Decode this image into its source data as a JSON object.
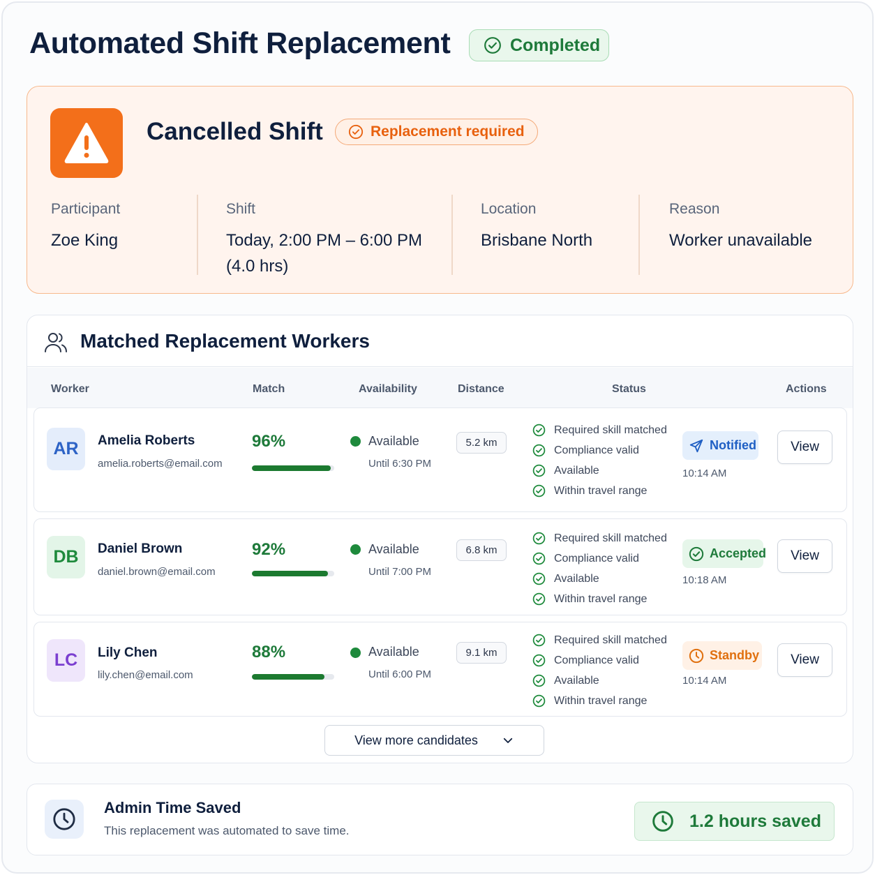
{
  "page": {
    "title": "Automated Shift Replacement",
    "status_badge": "Completed"
  },
  "cancelled": {
    "title": "Cancelled Shift",
    "badge": "Replacement required",
    "participant_label": "Participant",
    "participant_value": "Zoe King",
    "shift_label": "Shift",
    "shift_value_line1": "Today, 2:00 PM – 6:00 PM",
    "shift_value_line2": "(4.0 hrs)",
    "location_label": "Location",
    "location_value": "Brisbane North",
    "reason_label": "Reason",
    "reason_value": "Worker unavailable"
  },
  "matched": {
    "title": "Matched Replacement Workers",
    "columns": {
      "worker": "Worker",
      "match": "Match",
      "availability": "Availability",
      "distance": "Distance",
      "status": "Status",
      "actions": "Actions"
    },
    "rows": [
      {
        "initials": "AR",
        "name": "Amelia Roberts",
        "email": "amelia.roberts@email.com",
        "match": "96%",
        "match_value": 0.96,
        "availability": "Available",
        "until": "Until 6:30 PM",
        "distance": "5.2 km",
        "checks": [
          "Required skill matched",
          "Compliance valid",
          "Available",
          "Within travel range"
        ],
        "status": "Notified",
        "status_time": "10:14 AM",
        "action": "View",
        "colors": {
          "avatar_bg": "#e4edfb",
          "avatar_fg": "#2d63c6",
          "pill_bg": "#e4effc",
          "pill_fg": "#1f5fc4"
        }
      },
      {
        "initials": "DB",
        "name": "Daniel Brown",
        "email": "daniel.brown@email.com",
        "match": "92%",
        "match_value": 0.92,
        "availability": "Available",
        "until": "Until 7:00 PM",
        "distance": "6.8 km",
        "checks": [
          "Required skill matched",
          "Compliance valid",
          "Available",
          "Within travel range"
        ],
        "status": "Accepted",
        "status_time": "10:18 AM",
        "action": "View",
        "colors": {
          "avatar_bg": "#e3f5e8",
          "avatar_fg": "#1e8a3c",
          "pill_bg": "#e6f6ea",
          "pill_fg": "#1e7a3a"
        }
      },
      {
        "initials": "LC",
        "name": "Lily Chen",
        "email": "lily.chen@email.com",
        "match": "88%",
        "match_value": 0.88,
        "availability": "Available",
        "until": "Until 6:00 PM",
        "distance": "9.1 km",
        "checks": [
          "Required skill matched",
          "Compliance valid",
          "Available",
          "Within travel range"
        ],
        "status": "Standby",
        "status_time": "10:14 AM",
        "action": "View",
        "colors": {
          "avatar_bg": "#efe6fb",
          "avatar_fg": "#7b3fd0",
          "pill_bg": "#fff1e6",
          "pill_fg": "#e0700f"
        }
      }
    ],
    "more_button": "View more candidates"
  },
  "saved": {
    "title": "Admin Time Saved",
    "subtitle": "This replacement was automated to save time.",
    "pill": "1.2 hours saved"
  },
  "icons": {
    "completed": "check-circle-icon",
    "warning": "warning-triangle-icon",
    "replace": "check-circle-icon",
    "users": "users-icon",
    "check": "check-circle-icon",
    "notified": "send-icon",
    "accepted": "check-circle-icon",
    "standby": "clock-icon",
    "more": "chevron-down-icon",
    "admin": "clock-icon",
    "saved": "clock-icon"
  },
  "colors": {
    "primary_text": "#0f1f3d",
    "success": "#1e7a3a",
    "warning": "#f36f1a"
  }
}
